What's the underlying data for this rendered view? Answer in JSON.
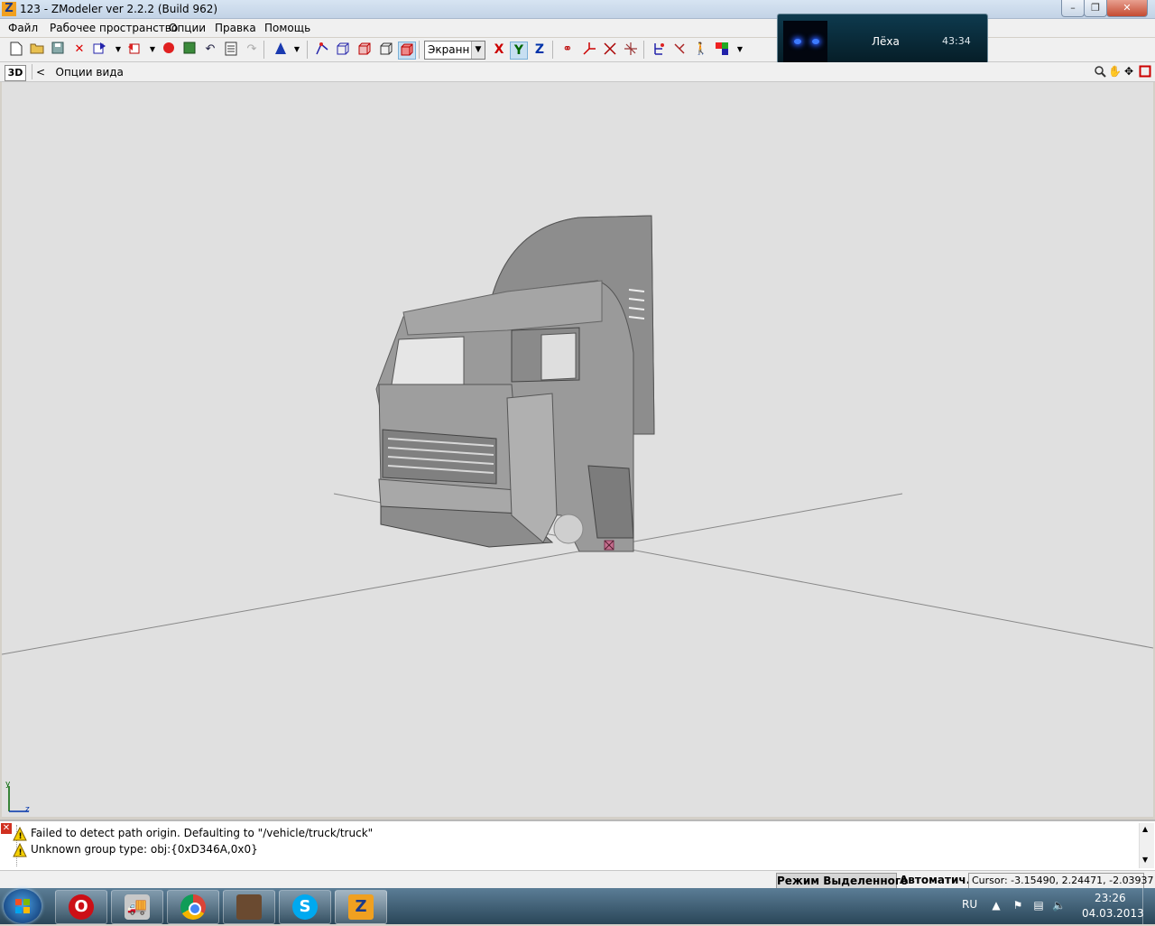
{
  "window": {
    "title": "123 - ZModeler ver 2.2.2 (Build 962)",
    "app_icon_letter": "Z",
    "min_label": "–",
    "max_label": "❐",
    "close_label": "✕"
  },
  "menu": {
    "file": "Файл",
    "workspace": "Рабочее пространство",
    "options": "Опции",
    "edit": "Правка",
    "help": "Помощь"
  },
  "toolbar": {
    "view_mode_value": "Экранн",
    "axis_x": "X",
    "axis_y": "Y",
    "axis_z": "Z",
    "axis_x_color": "#cc0000",
    "axis_y_color": "#006600",
    "axis_z_color": "#0033aa"
  },
  "notification": {
    "name": "Лёха",
    "time": "43:34"
  },
  "viewport_header": {
    "mode_label": "3D",
    "back_label": "<",
    "options_label": "Опции вида"
  },
  "viewport": {
    "axis_label_y": "y",
    "axis_label_z": "z",
    "background_color": "#e0e0e0"
  },
  "log": {
    "lines": [
      {
        "icon": "warning-icon",
        "text": "Failed to detect path origin. Defaulting to \"/vehicle/truck/truck\""
      },
      {
        "icon": "warning-icon",
        "text": "Unknown group type: obj:{0xD346A,0x0}"
      }
    ]
  },
  "statusbar": {
    "mode": "Режим Выделенного",
    "auto": "Автоматич.",
    "cursor": "Cursor: -3.15490, 2.24471, -2.03937"
  },
  "taskbar": {
    "apps": [
      {
        "name": "opera",
        "glyph": "O",
        "color": "#cc0f16"
      },
      {
        "name": "truck-app",
        "glyph": "",
        "color": "#c8c8c8"
      },
      {
        "name": "chrome",
        "glyph": "",
        "color": "#2a9b3c"
      },
      {
        "name": "game-avatar",
        "glyph": "",
        "color": "#6a4a30"
      },
      {
        "name": "skype",
        "glyph": "S",
        "color": "#00a9f0"
      },
      {
        "name": "zmodeler",
        "glyph": "Z",
        "color": "#f0a020"
      }
    ],
    "lang": "RU",
    "time": "23:26",
    "date": "04.03.2013"
  }
}
